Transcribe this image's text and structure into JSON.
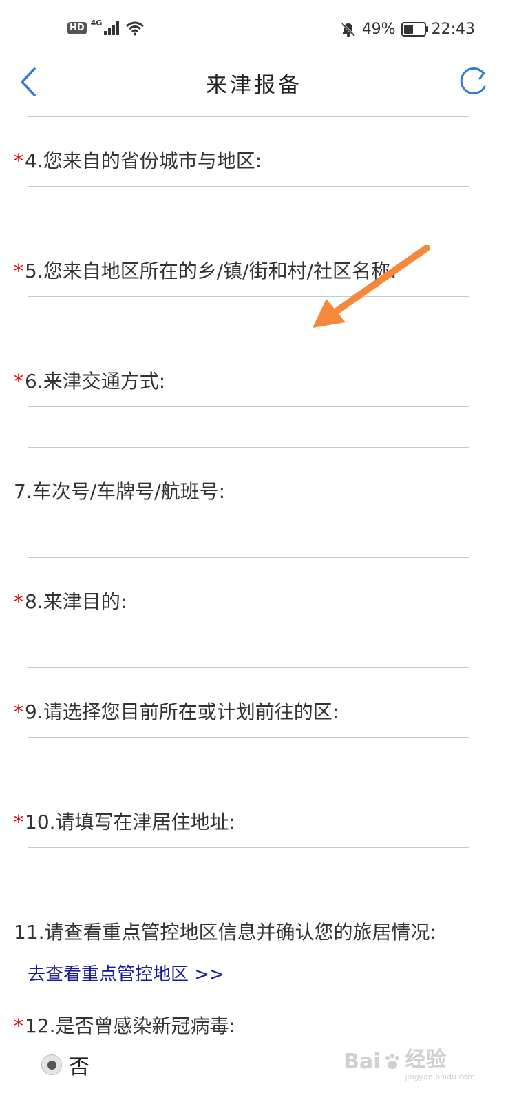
{
  "status_bar": {
    "hd": "HD",
    "network": "4G",
    "battery_percent": "49%",
    "battery_level": 0.49,
    "time": "22:43"
  },
  "nav": {
    "title": "来津报备",
    "back_icon": "chevron-left-icon",
    "refresh_icon": "refresh-icon"
  },
  "form": {
    "q4": {
      "required_mark": "*",
      "label": "4.您来自的省份城市与地区:",
      "value": ""
    },
    "q5": {
      "required_mark": "*",
      "label": "5.您来自地区所在的乡/镇/街和村/社区名称:",
      "value": ""
    },
    "q6": {
      "required_mark": "*",
      "label": "6.来津交通方式:",
      "value": ""
    },
    "q7": {
      "label": "7.车次号/车牌号/航班号:",
      "value": ""
    },
    "q8": {
      "required_mark": "*",
      "label": "8.来津目的:",
      "value": ""
    },
    "q9": {
      "required_mark": "*",
      "label": "9.请选择您目前所在或计划前往的区:",
      "value": ""
    },
    "q10": {
      "required_mark": "*",
      "label": "10.请填写在津居住地址:",
      "value": ""
    },
    "q11": {
      "label": "11.请查看重点管控地区信息并确认您的旅居情况:",
      "link": "去查看重点管控地区 >>"
    },
    "q12": {
      "required_mark": "*",
      "label": "12.是否曾感染新冠病毒:",
      "option_no": "否",
      "selected": "否"
    }
  },
  "watermark": {
    "brand": "Bai",
    "brand2": "经验",
    "url": "jingyan.baidu.com"
  },
  "colors": {
    "accent": "#2d7dd2",
    "required": "#e00000",
    "link": "#1a1a9c",
    "annotation_arrow": "#f5883a"
  }
}
